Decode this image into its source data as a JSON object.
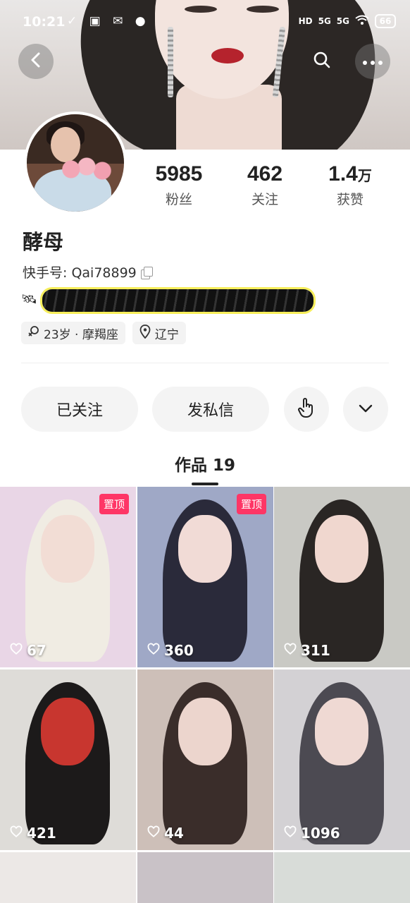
{
  "status_bar": {
    "time": "10:21",
    "notif_icons": "✓ ▣ ✉ ●",
    "hd": "HD",
    "net1": "5G",
    "net2": "5G",
    "battery": "66"
  },
  "profile": {
    "name": "酵母",
    "kuaishou_id": "快手号: Qai78899",
    "stats": [
      {
        "num": "5985",
        "unit": "",
        "label": "粉丝"
      },
      {
        "num": "462",
        "unit": "",
        "label": "关注"
      },
      {
        "num": "1.4",
        "unit": "万",
        "label": "获赞"
      }
    ],
    "tags": [
      {
        "icon": "gender-female-icon",
        "text": "23岁 · 摩羯座"
      },
      {
        "icon": "location-pin-icon",
        "text": "辽宁"
      }
    ]
  },
  "actions": {
    "follow_label": "已关注",
    "message_label": "发私信"
  },
  "works_tab": {
    "label": "作品 19"
  },
  "grid": [
    {
      "likes": "67",
      "pinned": true,
      "pinned_label": "置顶",
      "bg": "#e9d6e6",
      "hair": "#f0ece3",
      "skin": "#f2ddd5"
    },
    {
      "likes": "360",
      "pinned": true,
      "pinned_label": "置顶",
      "bg": "#9fa8c6",
      "hair": "#2a2a3a",
      "skin": "#f1dbd6"
    },
    {
      "likes": "311",
      "pinned": false,
      "pinned_label": "",
      "bg": "#c9c9c4",
      "hair": "#2a2624",
      "skin": "#f0d7cf"
    },
    {
      "likes": "421",
      "pinned": false,
      "pinned_label": "",
      "bg": "#dedcd8",
      "hair": "#1c1a1a",
      "skin": "#c8362f"
    },
    {
      "likes": "44",
      "pinned": false,
      "pinned_label": "",
      "bg": "#cdbfb8",
      "hair": "#3a2d2a",
      "skin": "#ecd5cd"
    },
    {
      "likes": "1096",
      "pinned": false,
      "pinned_label": "",
      "bg": "#d3d1d4",
      "hair": "#4c4a52",
      "skin": "#efd9d3"
    }
  ],
  "colors": {
    "pin_badge": "#fe3666",
    "pill_bg": "#f4f4f4"
  }
}
